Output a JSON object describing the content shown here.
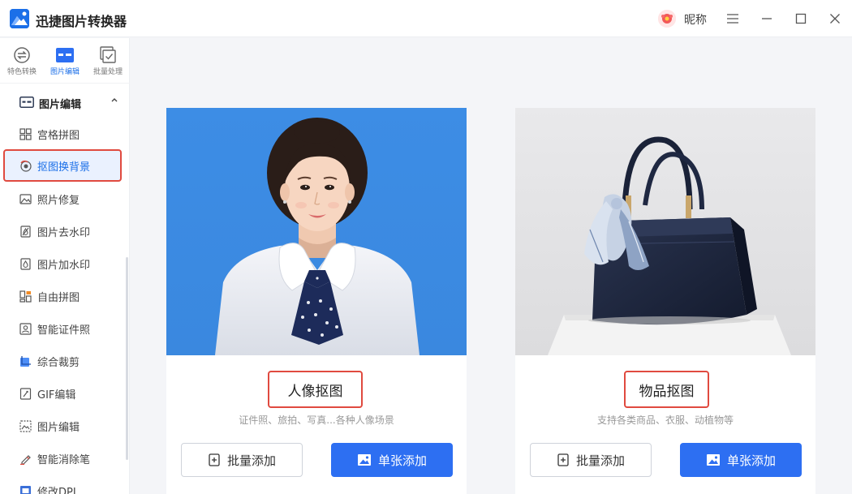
{
  "app": {
    "title": "迅捷图片转换器"
  },
  "user": {
    "nickname": "昵称"
  },
  "colors": {
    "accent": "#2d6ff2",
    "highlight": "#e04a3f",
    "portrait_bg": "#3d8de5"
  },
  "topnav": {
    "items": [
      {
        "label": "特色转换",
        "icon": "convert-icon"
      },
      {
        "label": "图片编辑",
        "icon": "image-edit-icon"
      },
      {
        "label": "批量处理",
        "icon": "batch-icon"
      }
    ],
    "active_index": 1
  },
  "sidebar": {
    "section_title": "图片编辑",
    "items": [
      {
        "label": "宫格拼图",
        "icon": "grid-icon"
      },
      {
        "label": "抠图换背景",
        "icon": "cutout-icon"
      },
      {
        "label": "照片修复",
        "icon": "photo-repair-icon"
      },
      {
        "label": "图片去水印",
        "icon": "remove-watermark-icon"
      },
      {
        "label": "图片加水印",
        "icon": "add-watermark-icon"
      },
      {
        "label": "自由拼图",
        "icon": "free-collage-icon"
      },
      {
        "label": "智能证件照",
        "icon": "id-photo-icon"
      },
      {
        "label": "综合裁剪",
        "icon": "crop-icon"
      },
      {
        "label": "GIF编辑",
        "icon": "gif-icon"
      },
      {
        "label": "图片编辑",
        "icon": "image-edit-icon"
      },
      {
        "label": "智能消除笔",
        "icon": "eraser-pen-icon"
      },
      {
        "label": "修改DPI",
        "icon": "dpi-icon"
      }
    ],
    "active_index": 1
  },
  "cards": [
    {
      "title": "人像抠图",
      "desc": "证件照、旅拍、写真...各种人像场景",
      "batch_label": "批量添加",
      "single_label": "单张添加"
    },
    {
      "title": "物品抠图",
      "desc": "支持各类商品、衣服、动植物等",
      "batch_label": "批量添加",
      "single_label": "单张添加"
    }
  ]
}
